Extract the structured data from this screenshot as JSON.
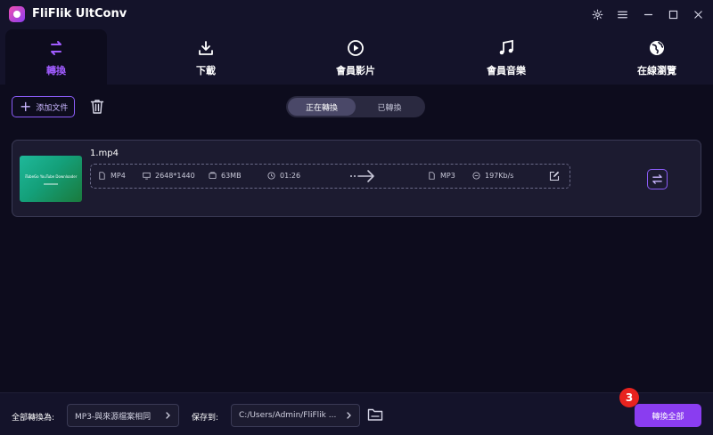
{
  "app": {
    "title": "FliFlik UltConv",
    "icons": [
      "app-logo",
      "settings-icon",
      "menu-icon",
      "minimize-icon",
      "maximize-icon",
      "close-icon"
    ]
  },
  "tabs": [
    {
      "label": "轉換",
      "icon": "convert-icon",
      "active": true
    },
    {
      "label": "下載",
      "icon": "download-icon",
      "active": false
    },
    {
      "label": "會員影片",
      "icon": "play-circle-icon",
      "active": false
    },
    {
      "label": "會員音樂",
      "icon": "music-note-icon",
      "active": false
    },
    {
      "label": "在線瀏覽",
      "icon": "globe-icon",
      "active": false
    }
  ],
  "toolbar": {
    "add_file_label": "添加文件",
    "segment": {
      "converting": "正在轉換",
      "converted": "已轉換",
      "selected": "converting"
    }
  },
  "file": {
    "name": "1.mp4",
    "thumbnail_text": "iTubeGo YouTube Downloader",
    "source": {
      "format": "MP4",
      "resolution": "2648*1440",
      "size": "63MB",
      "duration": "01:26"
    },
    "target": {
      "format": "MP3",
      "bitrate": "197Kb/s"
    }
  },
  "bottom": {
    "convert_all_to_label": "全部轉換為:",
    "convert_all_to_value": "MP3-與來源檔案相同",
    "save_to_label": "保存到:",
    "save_to_value": "C:/Users/Admin/FliFlik ...",
    "convert_all_button": "轉換全部",
    "step_badge": "3"
  },
  "colors": {
    "accent": "#8a3df0",
    "background": "#0d0c1d",
    "badge": "#e8231f"
  }
}
